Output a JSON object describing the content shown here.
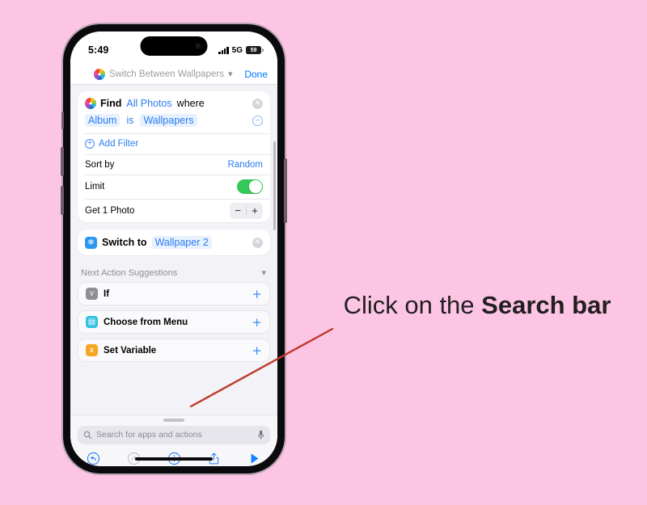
{
  "background_color": "#fcc5e4",
  "annotation": {
    "text_prefix": "Click on the ",
    "text_bold": "Search bar",
    "arrow_color": "#c0392b"
  },
  "phone": {
    "status_bar": {
      "time": "5:49",
      "network": "5G",
      "battery_level": "59",
      "signal_icon": "cellular-bars-icon",
      "battery_icon": "battery-icon"
    },
    "nav_bar": {
      "app_icon": "photos-app-icon",
      "title": "Switch Between Wallpapers",
      "chevron_icon": "chevron-down-icon",
      "done_label": "Done"
    },
    "actions": [
      {
        "type": "find",
        "icon": "photos-app-icon",
        "tokens": [
          "Find",
          "All Photos",
          "where"
        ],
        "filter_tokens": [
          "Album",
          "is",
          "Wallpapers"
        ],
        "remove_icon": "close-circle-icon",
        "minus_icon": "minus-circle-icon",
        "rows": [
          {
            "label": "Add Filter",
            "icon": "plus-circle-icon",
            "kind": "add"
          },
          {
            "label": "Sort by",
            "value": "Random",
            "kind": "value"
          },
          {
            "label": "Limit",
            "value": "on",
            "kind": "toggle"
          },
          {
            "label": "Get 1 Photo",
            "kind": "stepper",
            "minus": "−",
            "plus": "+"
          }
        ]
      },
      {
        "type": "switch",
        "icon": "settings-app-icon",
        "label": "Switch to",
        "parameter": "Wallpaper 2",
        "remove_icon": "close-circle-icon"
      }
    ],
    "suggestions": {
      "title": "Next Action Suggestions",
      "collapse_icon": "chevron-down-icon",
      "items": [
        {
          "label": "If",
          "icon": "if-icon",
          "icon_color": "#8e8e93",
          "glyph": "⑂",
          "add_icon": "plus-icon"
        },
        {
          "label": "Choose from Menu",
          "icon": "menu-icon",
          "icon_color": "#34c1e0",
          "glyph": "☰",
          "add_icon": "plus-icon"
        },
        {
          "label": "Set Variable",
          "icon": "variable-icon",
          "icon_color": "#f5a623",
          "glyph": "x",
          "add_icon": "plus-icon"
        }
      ]
    },
    "search": {
      "placeholder": "Search for apps and actions",
      "search_icon": "search-icon",
      "mic_icon": "microphone-icon"
    },
    "toolbar": [
      {
        "name": "undo-button",
        "icon": "undo-icon",
        "enabled": "true"
      },
      {
        "name": "redo-button",
        "icon": "redo-icon",
        "enabled": "false"
      },
      {
        "name": "info-button",
        "icon": "info-icon",
        "enabled": "true"
      },
      {
        "name": "share-button",
        "icon": "share-icon",
        "enabled": "true"
      },
      {
        "name": "run-button",
        "icon": "play-icon",
        "enabled": "true"
      }
    ]
  }
}
